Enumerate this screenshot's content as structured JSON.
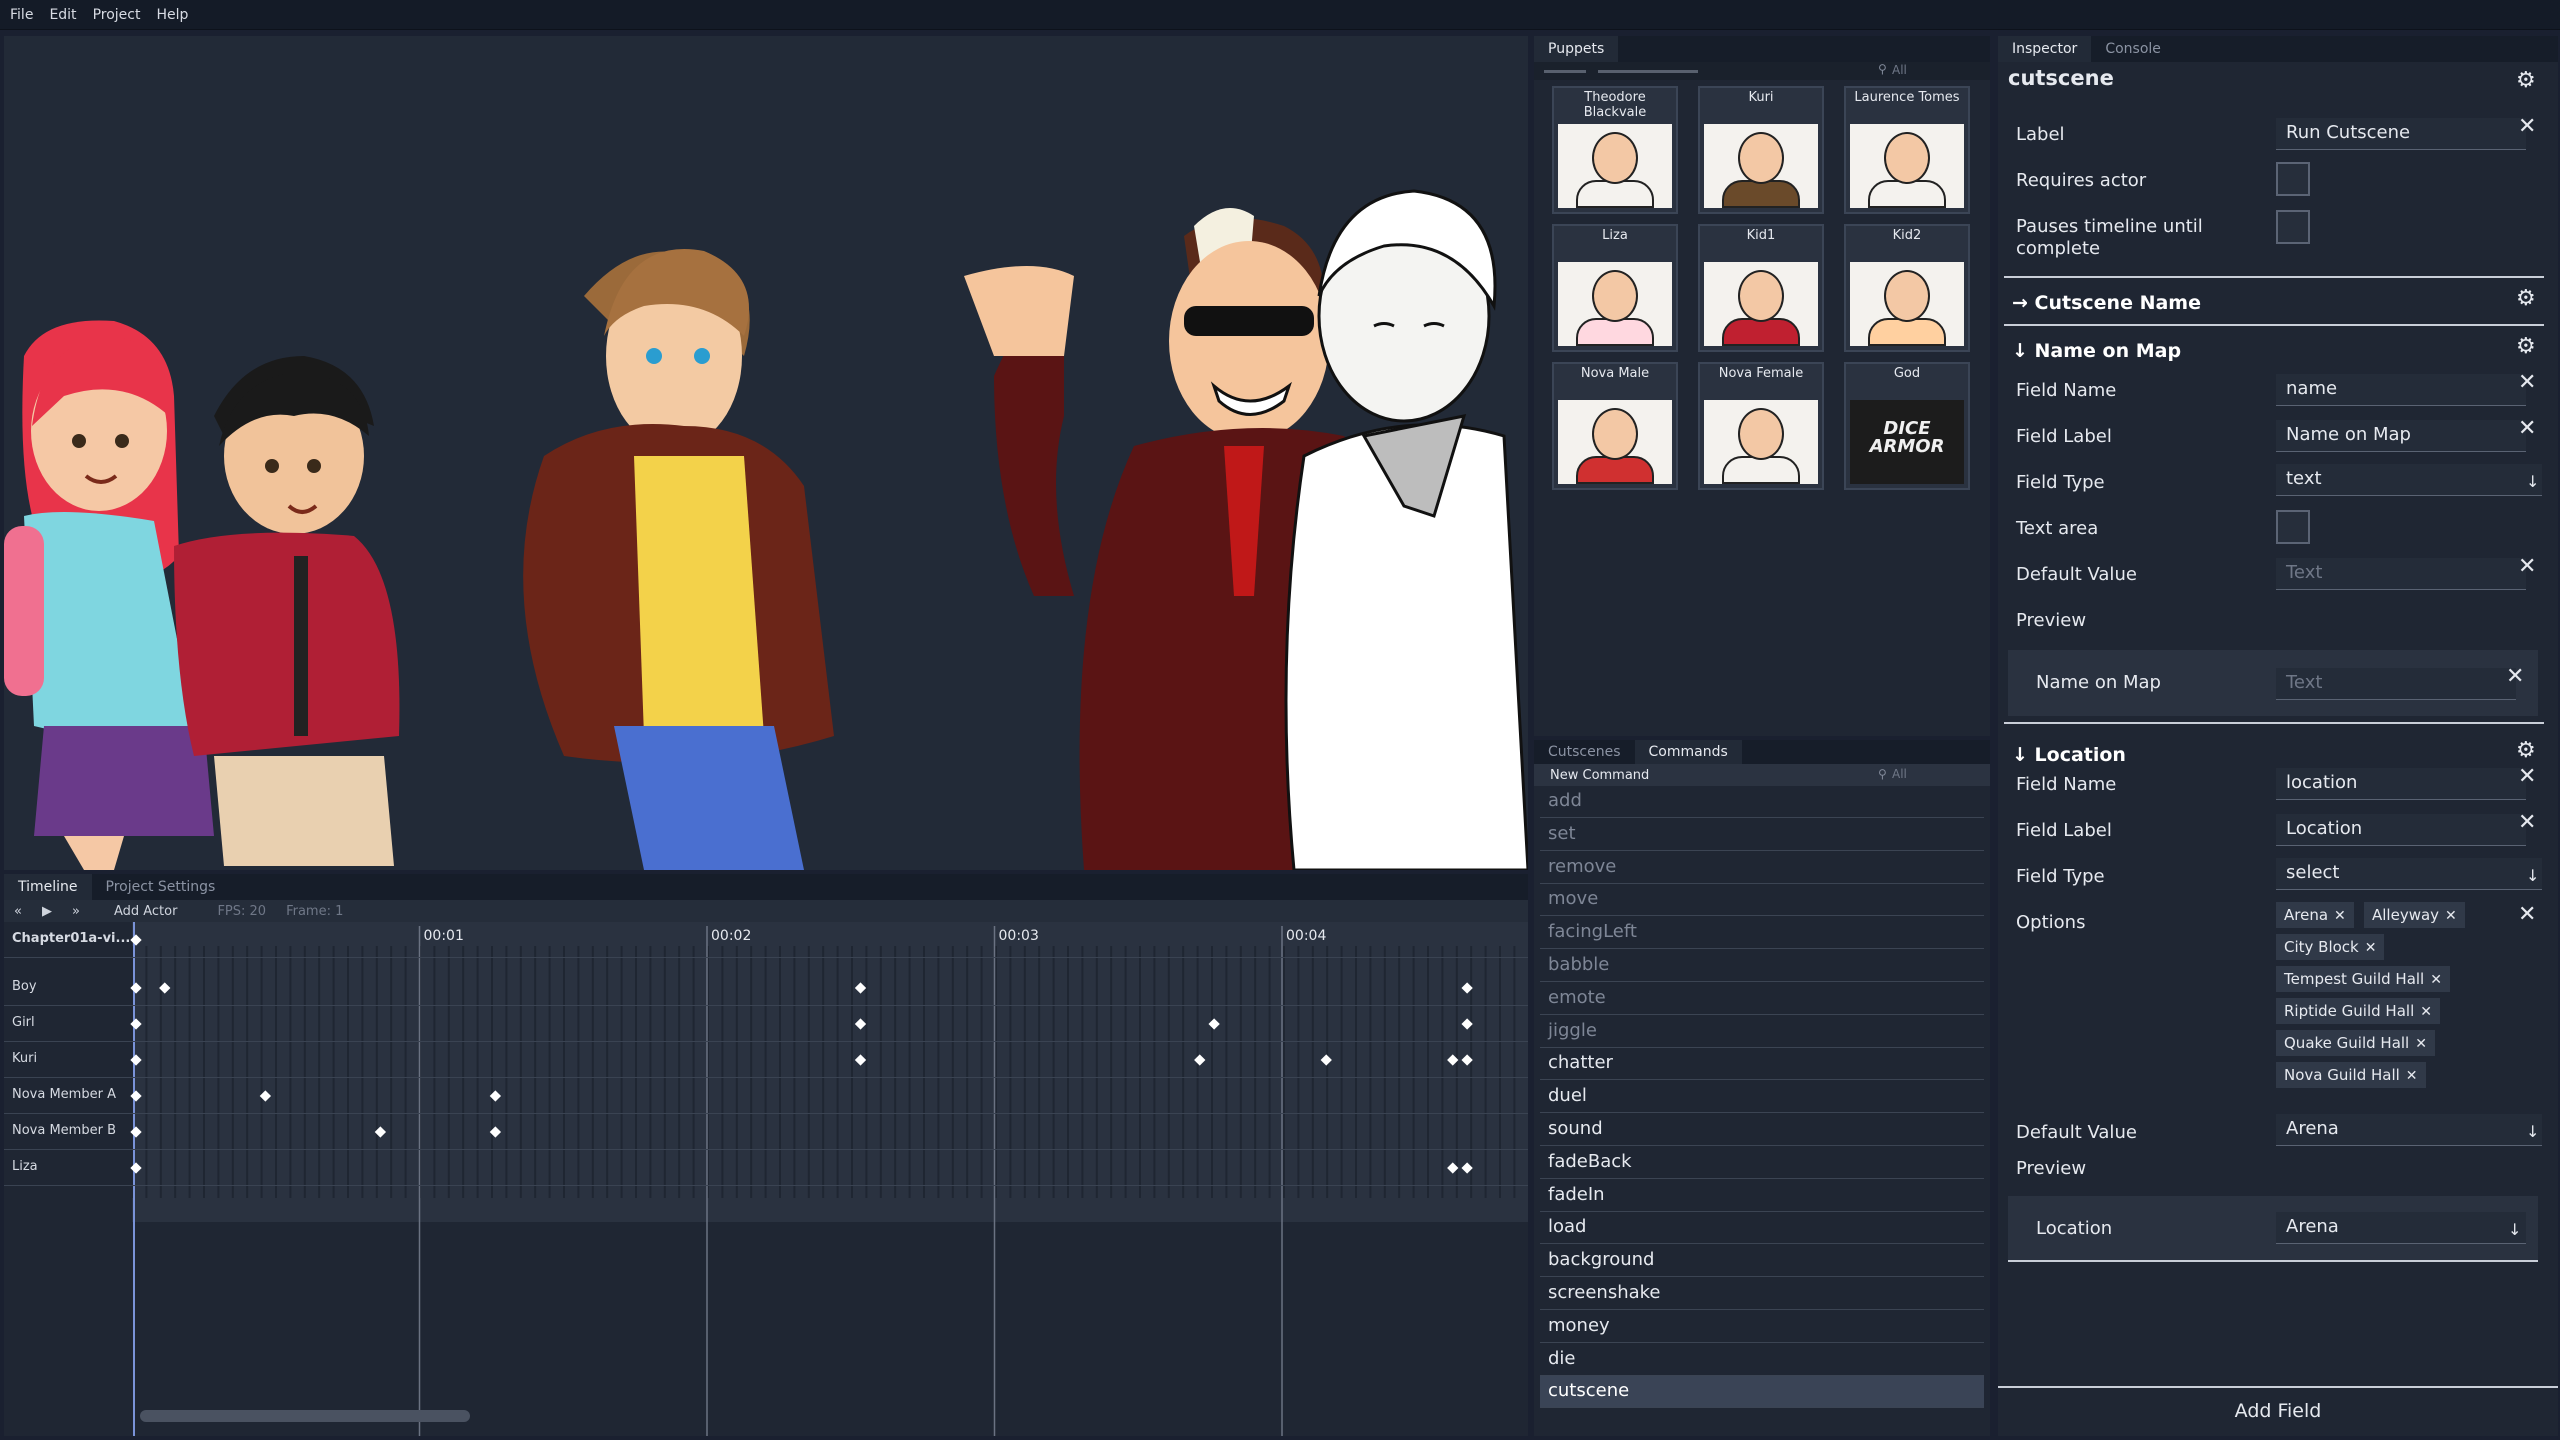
{
  "menu": [
    "File",
    "Edit",
    "Project",
    "Help"
  ],
  "timeline": {
    "tabs": [
      "Timeline",
      "Project Settings"
    ],
    "controls": [
      "«",
      "▶",
      "»"
    ],
    "add_actor": "Add Actor",
    "fps": "FPS: 20",
    "frame": "Frame: 1",
    "time_marks": [
      "00:01",
      "00:02",
      "00:03",
      "00:04"
    ],
    "rows": [
      {
        "label": "Chapter01a-vi...",
        "bold": true,
        "keys": [
          0
        ]
      },
      {
        "label": "Boy",
        "keys": [
          0,
          0.1,
          2.52,
          4.63
        ]
      },
      {
        "label": "Girl",
        "keys": [
          0,
          2.52,
          3.75,
          4.63
        ]
      },
      {
        "label": "Kuri",
        "keys": [
          0,
          2.52,
          3.7,
          4.14,
          4.58,
          4.63
        ]
      },
      {
        "label": "Nova Member A",
        "keys": [
          0,
          0.45,
          1.25
        ]
      },
      {
        "label": "Nova Member B",
        "keys": [
          0,
          0.85,
          1.25
        ]
      },
      {
        "label": "Liza",
        "keys": [
          0,
          4.58,
          4.63
        ]
      }
    ]
  },
  "puppets": {
    "tab": "Puppets",
    "search_placeholder": "All",
    "items": [
      {
        "name": "Theodore Blackvale"
      },
      {
        "name": "Kuri"
      },
      {
        "name": "Laurence Tomes"
      },
      {
        "name": "Liza"
      },
      {
        "name": "Kid1"
      },
      {
        "name": "Kid2"
      },
      {
        "name": "Nova Male"
      },
      {
        "name": "Nova Female"
      },
      {
        "name": "God"
      }
    ],
    "logo_text": [
      "DICE",
      "ARMOR"
    ]
  },
  "commands": {
    "tabs": [
      "Cutscenes",
      "Commands"
    ],
    "new_command": "New Command",
    "search_placeholder": "All",
    "items": [
      {
        "label": "add",
        "state": "dim"
      },
      {
        "label": "set",
        "state": "dim"
      },
      {
        "label": "remove",
        "state": "dim"
      },
      {
        "label": "move",
        "state": "dim"
      },
      {
        "label": "facingLeft",
        "state": "dim"
      },
      {
        "label": "babble",
        "state": "dim"
      },
      {
        "label": "emote",
        "state": "dim"
      },
      {
        "label": "jiggle",
        "state": "dim"
      },
      {
        "label": "chatter",
        "state": "bright"
      },
      {
        "label": "duel",
        "state": "bright"
      },
      {
        "label": "sound",
        "state": "bright"
      },
      {
        "label": "fadeBack",
        "state": "bright"
      },
      {
        "label": "fadeIn",
        "state": "bright"
      },
      {
        "label": "load",
        "state": "bright"
      },
      {
        "label": "background",
        "state": "bright"
      },
      {
        "label": "screenshake",
        "state": "bright"
      },
      {
        "label": "money",
        "state": "bright"
      },
      {
        "label": "die",
        "state": "bright"
      },
      {
        "label": "cutscene",
        "state": "selected"
      }
    ]
  },
  "inspector": {
    "tabs": [
      "Inspector",
      "Console"
    ],
    "title": "cutscene",
    "label_label": "Label",
    "label_value": "Run Cutscene",
    "requires_actor": "Requires actor",
    "pauses_line1": "Pauses timeline until",
    "pauses_line2": "complete",
    "cutscene_name_section": "→ Cutscene Name",
    "name_on_map": {
      "section": "↓ Name on Map",
      "field_name_label": "Field Name",
      "field_name": "name",
      "field_label_label": "Field Label",
      "field_label": "Name on Map",
      "field_type_label": "Field Type",
      "field_type": "text",
      "text_area_label": "Text area",
      "default_value_label": "Default Value",
      "default_value_placeholder": "Text",
      "preview_label": "Preview",
      "preview_field_label": "Name on Map",
      "preview_placeholder": "Text"
    },
    "location": {
      "section": "↓ Location",
      "field_name_label": "Field Name",
      "field_name": "location",
      "field_label_label": "Field Label",
      "field_label": "Location",
      "field_type_label": "Field Type",
      "field_type": "select",
      "options_label": "Options",
      "options": [
        "Arena",
        "Alleyway",
        "City Block",
        "Tempest Guild Hall",
        "Riptide Guild Hall",
        "Quake Guild Hall",
        "Nova Guild Hall"
      ],
      "default_value_label": "Default Value",
      "default_value": "Arena",
      "preview_label": "Preview",
      "preview_field_label": "Location",
      "preview_value": "Arena"
    },
    "add_field": "Add Field"
  },
  "colors": {
    "background": "#1f2633",
    "menubar": "#141b27",
    "selected_row": "#3a4456",
    "keyframe": "#ffffff"
  }
}
